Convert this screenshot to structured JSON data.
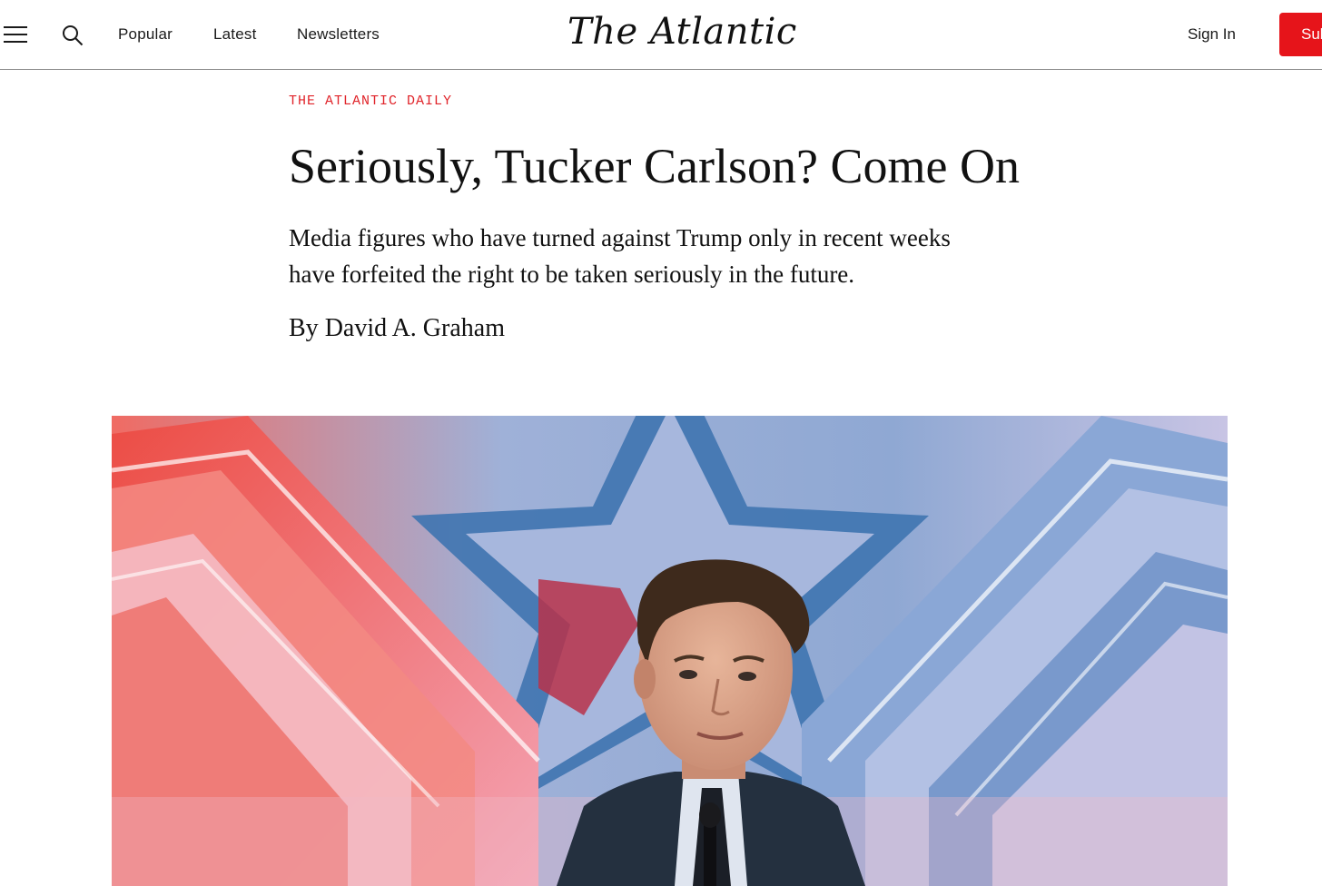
{
  "header": {
    "nav": {
      "popular": "Popular",
      "latest": "Latest",
      "newsletters": "Newsletters"
    },
    "logo_text": "The Atlantic",
    "sign_in": "Sign In",
    "subscribe": "Subscribe",
    "icons": [
      "menu-icon",
      "search-icon"
    ]
  },
  "article": {
    "kicker": "THE ATLANTIC DAILY",
    "headline": "Seriously, Tucker Carlson? Come On",
    "dek": "Media figures who have turned against Trump only in recent weeks have forfeited the right to be taken seriously in the future.",
    "byline_prefix": "By",
    "author": "David A. Graham"
  },
  "colors": {
    "accent_red": "#e6141a",
    "kicker_red": "#e0242a",
    "text": "#111111"
  }
}
